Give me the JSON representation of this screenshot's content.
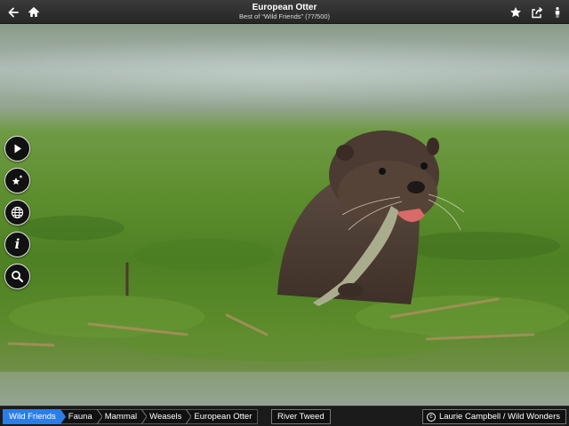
{
  "header": {
    "title": "European Otter",
    "subtitle": "Best of “Wild Friends” (77/500)",
    "left_icons": [
      "back-arrow-icon",
      "home-icon"
    ],
    "right_icons": [
      "star-icon",
      "share-icon",
      "person-icon"
    ]
  },
  "photo": {
    "subject": "otter-eating-fish-photo"
  },
  "side_controls": [
    "play-icon",
    "sparkle-stars-icon",
    "globe-icon",
    "info-icon",
    "search-icon"
  ],
  "breadcrumb": {
    "items": [
      "Wild Friends",
      "Fauna",
      "Mammal",
      "Weasels",
      "European Otter"
    ],
    "active_color": "#2a7ee8"
  },
  "footer": {
    "tag": "River Tweed",
    "credit_symbol": "c",
    "credit": "Laurie Campbell / Wild Wonders"
  }
}
